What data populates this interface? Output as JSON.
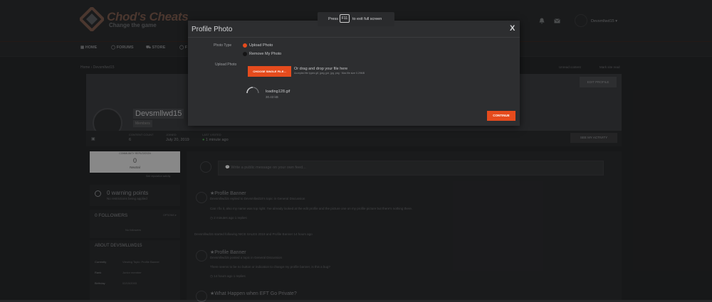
{
  "colors": {
    "accent": "#e54b1d",
    "background": "#262729",
    "panel": "#2b2c2e"
  },
  "site": {
    "name": "Chod's Cheats",
    "tagline": "Change the game"
  },
  "header": {
    "user": "Devsmllwd15 ▾"
  },
  "nav": {
    "items": [
      "HOME",
      "FORUMS",
      "STORE",
      "F"
    ]
  },
  "breadcrumb": {
    "trail": "Home › Devsmllwd15",
    "right_a": "Unread content",
    "right_b": "Mark site read"
  },
  "profile": {
    "name": "Devsmllwd15",
    "group": "Members",
    "edit_label": "EDIT PROFILE",
    "stats": [
      {
        "label": "CONTENT COUNT",
        "value": "6"
      },
      {
        "label": "JOINED",
        "value": "July 20, 2019"
      },
      {
        "label": "LAST VISITED",
        "value": "1 minute ago"
      }
    ],
    "activity_label": "SEE MY ACTIVITY"
  },
  "sidebar": {
    "reputation": {
      "title": "COMMUNITY REPUTATION",
      "value": "0",
      "label": "Neutral",
      "link": "See reputation activity"
    },
    "warnings": {
      "title": "0 warning points",
      "subtitle": "No restrictions being applied"
    },
    "followers": {
      "title": "0 FOLLOWERS",
      "options": "OPTIONS ▾",
      "empty": "No followers"
    },
    "about": {
      "title": "ABOUT DEVSMLLWD15",
      "rows": [
        {
          "label": "Currently",
          "value": "Viewing Topic: Profile Banner"
        },
        {
          "label": "Rank",
          "value": "Junior member"
        },
        {
          "label": "Birthday",
          "value": "02/15/2003"
        }
      ]
    }
  },
  "feed": {
    "status_placeholder": "Write a public message on your own feed...",
    "posts": [
      {
        "title": "Profile Banner",
        "meta": "Devsmllwd15 replied to Devsmllwd15's topic in General Discussion",
        "body": "Can I fix it, also my name was top right. I've already looked at the edit profile and the picture one on my profile picture but there's nothing there.",
        "stats": "2 minutes ago    1 replies"
      },
      {
        "activity": "Devsmllwd15 started following NICE SALES 2019 and Profile Banner    14 hours ago"
      },
      {
        "title": "Profile Banner",
        "meta": "Devsmllwd15 posted a topic in General Discussion",
        "body": "There seems to be no button or indication to change my profile banner, is this a bug?",
        "stats": "14 hours ago    1 replies"
      },
      {
        "title": "What Happen when EFT Go Private?",
        "meta": ""
      }
    ]
  },
  "modal": {
    "title": "Profile Photo",
    "close": "X",
    "type_label": "Photo Type",
    "options": [
      "Upload Photo",
      "Remove My Photo"
    ],
    "upload_label": "Upload Photo",
    "choose_button": "CHOOSE SINGLE FILE...",
    "drop_text": "Or drag and drop your file here",
    "accepted": "Accepted file types gif, jpeg, jpe, jpg, png · Max file size 0.29MB",
    "file_name": "loading128.gif",
    "file_size": "30.43 kB",
    "continue_button": "CONTINUE"
  },
  "fullscreen_tip": {
    "press": "Press",
    "key": "F11",
    "rest": "to exit full screen"
  }
}
